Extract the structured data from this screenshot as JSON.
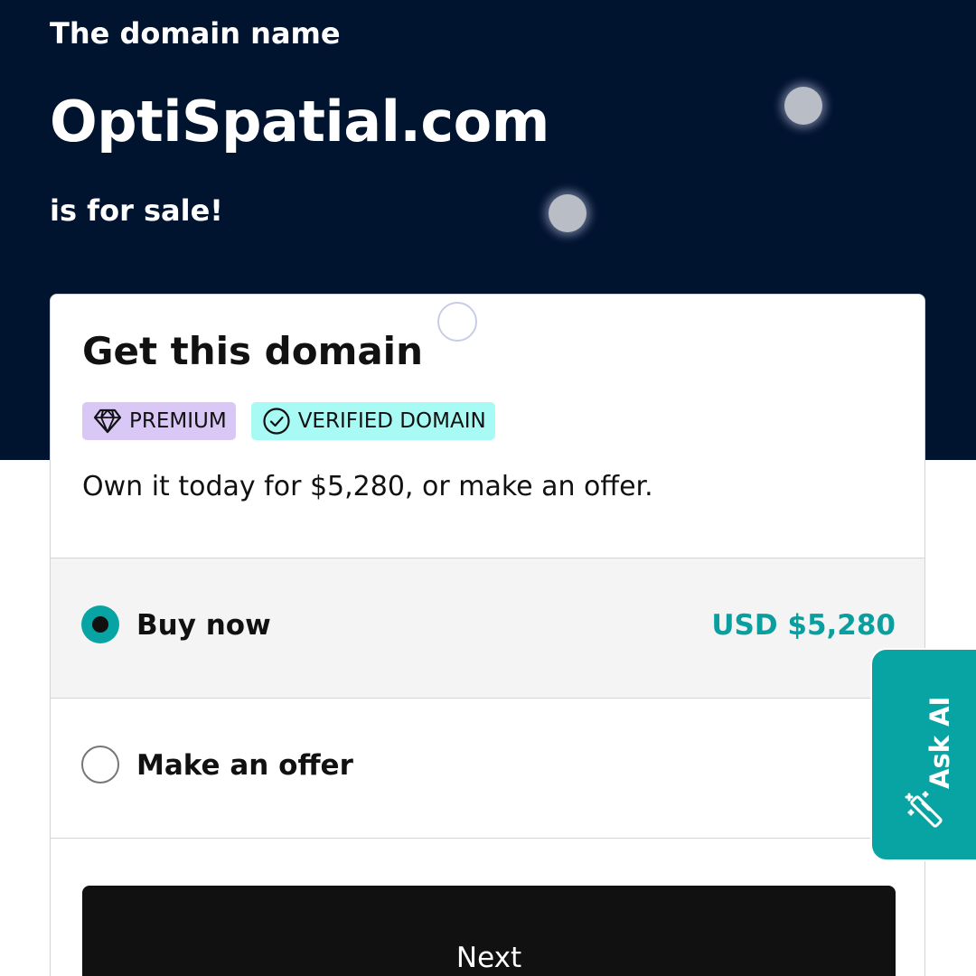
{
  "hero": {
    "eyebrow": "The domain name",
    "domain": "OptiSpatial.com",
    "status": "is for sale!"
  },
  "card": {
    "title": "Get this domain",
    "badges": [
      {
        "label": "PREMIUM",
        "icon": "diamond-icon",
        "color": "#d9c8f6"
      },
      {
        "label": "VERIFIED DOMAIN",
        "icon": "check-circle-icon",
        "color": "#a8fbf4"
      }
    ],
    "description": "Own it today for $5,280, or make an offer.",
    "options": [
      {
        "label": "Buy now",
        "price": "USD $5,280",
        "selected": true
      },
      {
        "label": "Make an offer",
        "selected": false
      }
    ],
    "next_label": "Next"
  },
  "ask_ai": {
    "label": "Ask AI",
    "icon": "magic-wand-icon"
  },
  "colors": {
    "hero_bg": "#00132f",
    "accent": "#08a3a3",
    "price": "#0a9e9e",
    "button": "#111111"
  }
}
